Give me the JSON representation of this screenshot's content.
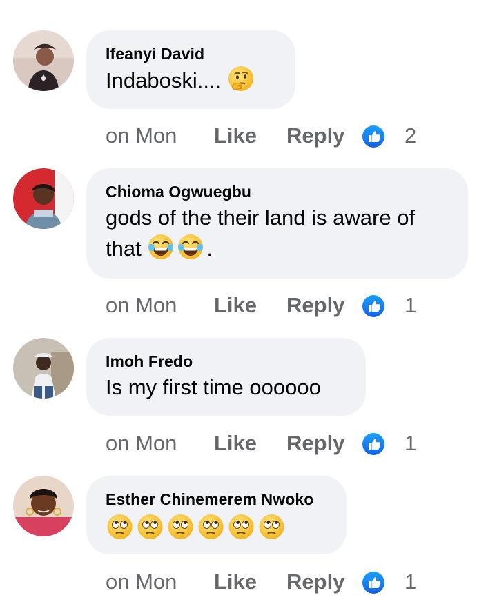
{
  "comments": [
    {
      "author": "Ifeanyi David",
      "text": "Indaboski....",
      "emojis": [
        "thinking-face"
      ],
      "time": "on Mon",
      "like_label": "Like",
      "reply_label": "Reply",
      "reaction": "like-reaction",
      "reaction_count": "2"
    },
    {
      "author": "Chioma Ogwuegbu",
      "text_line1": "gods of the their land is aware of",
      "text_line2_prefix": "that",
      "text_line2_suffix": ".",
      "emojis": [
        "tears-of-joy",
        "tears-of-joy"
      ],
      "time": "on Mon",
      "like_label": "Like",
      "reply_label": "Reply",
      "reaction": "like-reaction",
      "reaction_count": "1"
    },
    {
      "author": "Imoh Fredo",
      "text": "Is my first time oooooo",
      "time": "on Mon",
      "like_label": "Like",
      "reply_label": "Reply",
      "reaction": "like-reaction",
      "reaction_count": "1"
    },
    {
      "author": "Esther Chinemerem Nwoko",
      "emojis": [
        "rolling-eyes",
        "rolling-eyes",
        "rolling-eyes",
        "rolling-eyes",
        "rolling-eyes",
        "rolling-eyes"
      ],
      "time": "on Mon",
      "like_label": "Like",
      "reply_label": "Reply",
      "reaction": "like-reaction",
      "reaction_count": "1"
    }
  ],
  "colors": {
    "bubble": "#f0f2f5",
    "text": "#050505",
    "meta": "#65676b",
    "like_blue": "#1877f2",
    "emoji_yellow": "#fbc531"
  }
}
